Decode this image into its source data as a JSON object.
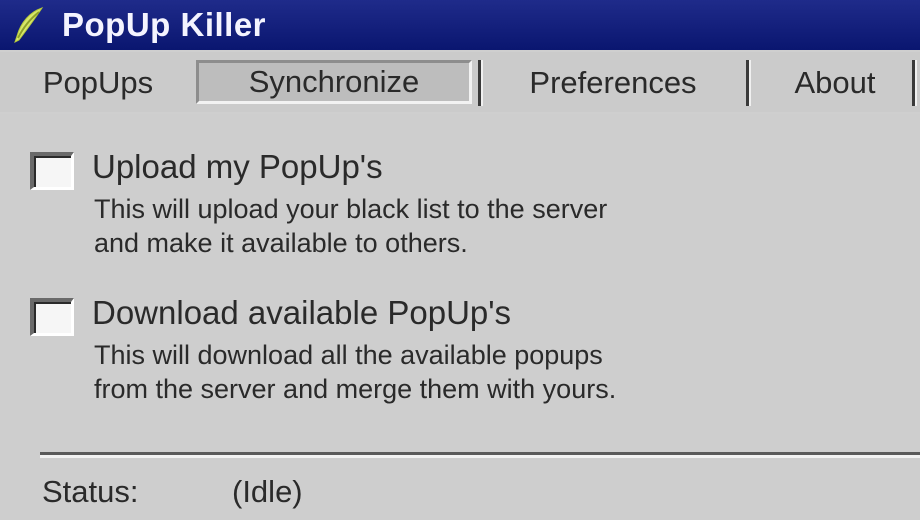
{
  "window": {
    "title": "PopUp Killer",
    "icon": "feather-pen-icon"
  },
  "tabs": [
    {
      "label": "PopUps",
      "selected": false
    },
    {
      "label": "Synchronize",
      "selected": true
    },
    {
      "label": "Preferences",
      "selected": false
    },
    {
      "label": "About",
      "selected": false
    }
  ],
  "options": [
    {
      "label": "Upload my PopUp's",
      "checked": false,
      "description_lines": [
        "This will upload your black list to the server",
        "and make it available to others."
      ]
    },
    {
      "label": "Download available PopUp's",
      "checked": false,
      "description_lines": [
        "This will download all the available popups",
        "from the server and merge them with yours."
      ]
    }
  ],
  "status": {
    "label": "Status:",
    "value": "(Idle)"
  },
  "colors": {
    "titlebar": "#0a1670",
    "titlebar_text": "#f4f4ff",
    "panel": "#cecece",
    "text": "#2a2a2a"
  }
}
